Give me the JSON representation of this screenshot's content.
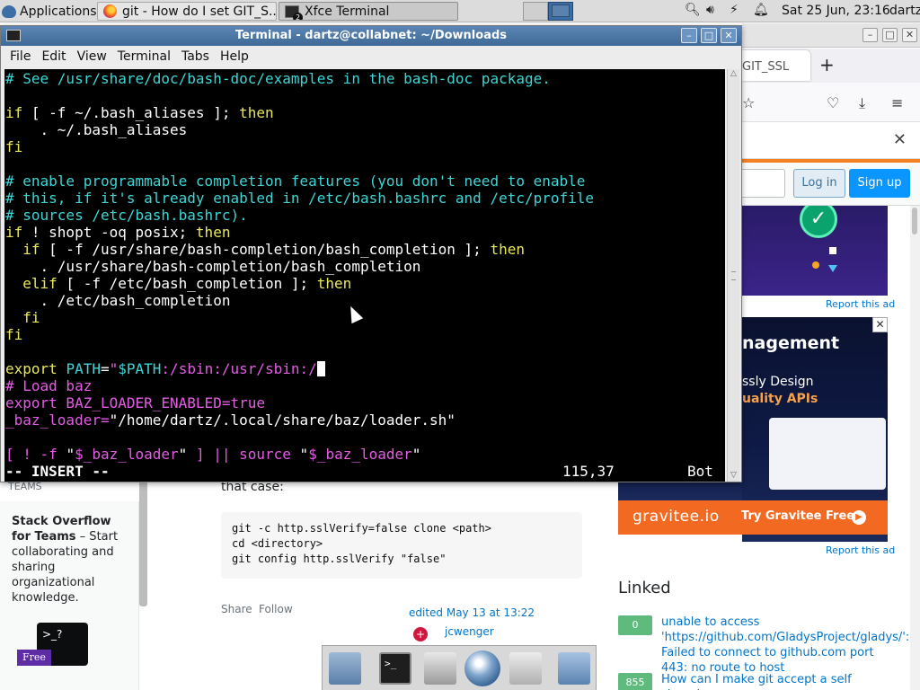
{
  "panel": {
    "applications_label": "Applications",
    "tasks": [
      {
        "label": "git - How do I set GIT_S..."
      },
      {
        "label": "Xfce Terminal",
        "badge": "2"
      }
    ],
    "clock": "Sat 25 Jun, 23:16",
    "user": "dartz"
  },
  "browser": {
    "tab_label": "GIT_SSL",
    "new_tab": "+",
    "login_label": "Log in",
    "signup_label": "Sign up",
    "report_ad": "Report this ad",
    "ad2": {
      "headline": "nagement",
      "line1": "ssly Design",
      "line2": "uality APIs",
      "logo": "gravitee.io",
      "cta": "Try Gravitee Free"
    },
    "teams_label": "TEAMS",
    "teams_card": {
      "title": "Stack Overflow for Teams",
      "text": " – Start collaborating and sharing organizational knowledge.",
      "free_badge": "Free",
      "prompt": ">_?"
    },
    "answer": {
      "intro": "that case:",
      "code": "git -c http.sslVerify=false clone <path>\ncd <directory>\ngit config http.sslVerify \"false\"",
      "share": "Share",
      "follow": "Follow",
      "edited": "edited May 13 at 13:22",
      "editor": "jcwenger"
    },
    "linked": {
      "heading": "Linked",
      "items": [
        {
          "score": "0",
          "title": "unable to access 'https://github.com/GladysProject/gladys/': Failed to connect to github.com port 443: no route to host"
        },
        {
          "score": "855",
          "title": "How can I make git accept a self signed"
        }
      ]
    }
  },
  "terminal": {
    "title": "Terminal - dartz@collabnet: ~/Downloads",
    "menu": [
      "File",
      "Edit",
      "View",
      "Terminal",
      "Tabs",
      "Help"
    ],
    "mode": "-- INSERT --",
    "position": "115,37",
    "scroll": "Bot"
  }
}
